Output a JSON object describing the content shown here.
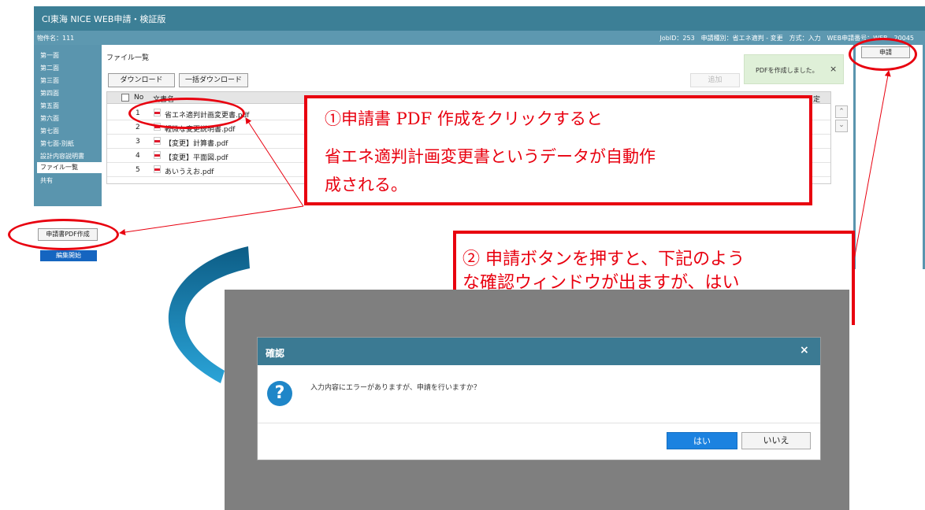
{
  "app": {
    "title": "CI東海 NICE WEB申請・検証版"
  },
  "subheader": {
    "bukken": "物件名：111",
    "info": "JobID：253　申請種別：省エネ適判 - 変更　方式：入力　WEB申請番号：WEB…20045"
  },
  "sidebar": {
    "items": [
      "第一面",
      "第二面",
      "第三面",
      "第四面",
      "第五面",
      "第六面",
      "第七面",
      "第七面-別紙",
      "設計内容説明書",
      "ファイル一覧",
      "共有"
    ],
    "active_index": 9,
    "pdf_button": "申請書PDF作成",
    "edit_button": "編集開始"
  },
  "main": {
    "heading": "ファイル一覧",
    "download_button": "ダウンロード",
    "bulk_download_button": "一括ダウンロード",
    "add_button": "追加",
    "toast": "PDFを作成しました。",
    "toast_close": "×",
    "table": {
      "col_no": "No",
      "col_name": "文書名",
      "col_right": "定",
      "rows": [
        {
          "no": "1",
          "name": "省エネ適判計画変更書.pdf"
        },
        {
          "no": "2",
          "name": "軽微な変更説明書.pdf"
        },
        {
          "no": "3",
          "name": "【変更】計算書.pdf"
        },
        {
          "no": "4",
          "name": "【変更】平面図.pdf"
        },
        {
          "no": "5",
          "name": "あいうえお.pdf"
        }
      ]
    }
  },
  "right_panel": {
    "apply_button": "申請"
  },
  "annotations": {
    "note1_line1": "①申請書 PDF 作成をクリックすると",
    "note1_line2": "省エネ適判計画変更書というデータが自動作",
    "note1_line3": "成される。",
    "note2_line1": "② 申請ボタンを押すと、下記のよう",
    "note2_line2": "な確認ウィンドウが出ますが、はい"
  },
  "dialog": {
    "title": "確認",
    "close": "×",
    "message": "入力内容にエラーがありますが、申請を行いますか？",
    "yes": "はい",
    "no": "いいえ",
    "icon_glyph": "?"
  },
  "colors": {
    "accent": "#3c7f96",
    "annotation_red": "#e8000f",
    "primary_button": "#1c82e0"
  }
}
